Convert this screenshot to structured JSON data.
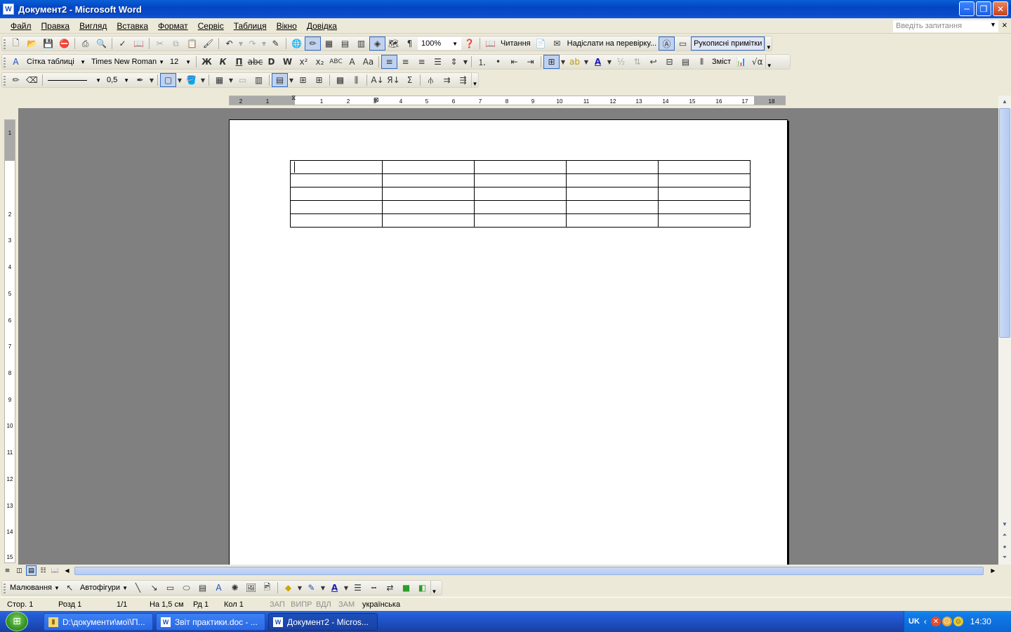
{
  "window": {
    "title": "Документ2 - Microsoft Word",
    "app_icon_letter": "W",
    "buttons": {
      "minimize": "─",
      "maximize": "❐",
      "close": "✕"
    }
  },
  "menu": {
    "items": [
      "Файл",
      "Правка",
      "Вигляд",
      "Вставка",
      "Формат",
      "Сервіс",
      "Таблиця",
      "Вікно",
      "Довідка"
    ],
    "ask_placeholder": "Введіть запитання",
    "close_doc": "×"
  },
  "standard_toolbar": {
    "zoom": "100%",
    "reading_label": "Читання",
    "send_review_label": "Надіслати на перевірку...",
    "ink_annotations_label": "Рукописні примітки"
  },
  "formatting_toolbar": {
    "style": "Сітка таблиці",
    "font": "Times New Roman",
    "size": "12",
    "bold": "Ж",
    "italic": "К",
    "underline": "П",
    "toc_label": "Зміст"
  },
  "tables_toolbar": {
    "line_weight": "0,5"
  },
  "ruler": {
    "corner": "L",
    "h_ticks": [
      "2",
      "1",
      "1",
      "2",
      "3",
      "4",
      "5",
      "6",
      "7",
      "8",
      "9",
      "10",
      "11",
      "12",
      "13",
      "14",
      "15",
      "16",
      "17",
      "18"
    ],
    "v_ticks": [
      "1",
      "2",
      "3",
      "4",
      "5",
      "6",
      "7",
      "8",
      "9",
      "10",
      "11",
      "12",
      "13",
      "14",
      "15"
    ]
  },
  "document": {
    "table": {
      "rows": 5,
      "cols": 5
    }
  },
  "drawing_toolbar": {
    "draw_label": "Малювання",
    "autoshapes_label": "Автофігури"
  },
  "status": {
    "page": "Стор.  1",
    "section": "Розд  1",
    "pages": "1/1",
    "at": "На  1,5 см",
    "line": "Рд  1",
    "col": "Кол  1",
    "rec": "ЗАП",
    "trk": "ВИПР",
    "ext": "ВДЛ",
    "ovr": "ЗАМ",
    "language": "українська"
  },
  "taskbar": {
    "tasks": [
      {
        "label": "D:\\документи\\мої\\П...",
        "icon": "folder"
      },
      {
        "label": "Звіт практики.doc - ...",
        "icon": "word"
      },
      {
        "label": "Документ2 - Micros...",
        "icon": "word"
      }
    ],
    "lang": "UK",
    "clock": "14:30"
  }
}
